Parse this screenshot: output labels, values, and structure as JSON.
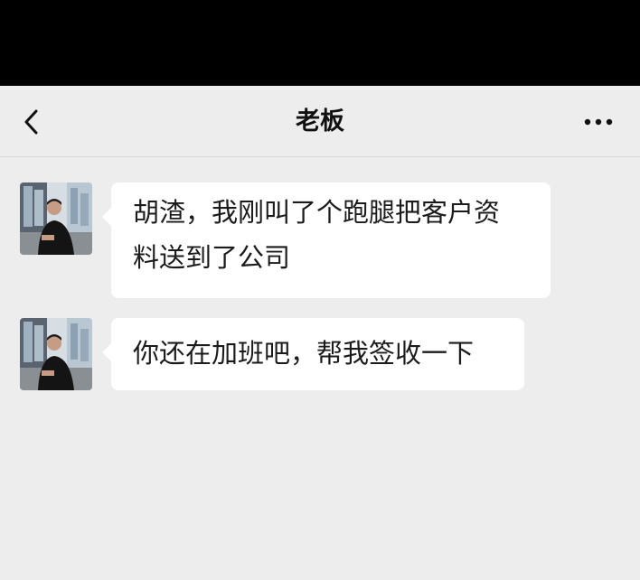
{
  "status_bar": {},
  "header": {
    "title": "老板",
    "back_icon": "chevron-left-icon",
    "more_icon": "more-horizontal-icon"
  },
  "messages": [
    {
      "sender": "老板",
      "avatar_icon": "avatar",
      "text_lines": [
        "胡渣，我刚叫了个跑腿把客户资",
        "料送到了公司"
      ]
    },
    {
      "sender": "老板",
      "avatar_icon": "avatar",
      "text_lines": [
        "你还在加班吧，帮我签收一下"
      ]
    }
  ],
  "colors": {
    "background": "#ededed",
    "bubble": "#ffffff",
    "status_bar": "#000000",
    "text": "#1b1b1b"
  }
}
